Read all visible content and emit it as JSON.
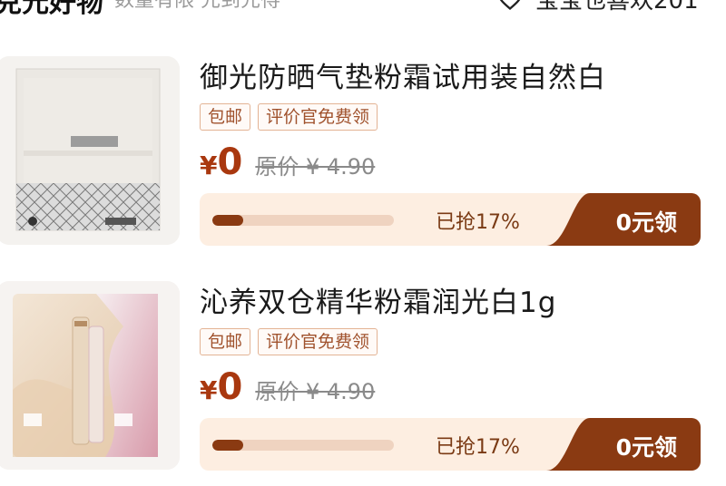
{
  "header": {
    "title": "兑元好物",
    "subtitle": "数量有限 先到先得",
    "favorites_label": "宝宝也喜欢201"
  },
  "products": [
    {
      "title": "御光防晒气垫粉霜试用装自然白",
      "tags": [
        "包邮",
        "评价官免费领"
      ],
      "currency": "¥",
      "price": "0",
      "original_price": "原价 ¥ 4.90",
      "progress": 0.17,
      "grabbed_text": "已抢17%",
      "claim_label": "0元领",
      "image_icon": "sunscreen-cushion-sample-sachet"
    },
    {
      "title": "沁养双仓精华粉霜润光白1g",
      "tags": [
        "包邮",
        "评价官免费领"
      ],
      "currency": "¥",
      "price": "0",
      "original_price": "原价 ¥ 4.90",
      "progress": 0.17,
      "grabbed_text": "已抢17%",
      "claim_label": "0元领",
      "image_icon": "dual-chamber-serum-foundation-sample"
    }
  ],
  "colors": {
    "accent": "#a9380f",
    "button": "#8a3a12",
    "bar_bg": "#fdeee1",
    "tag_text": "#a0522d"
  }
}
